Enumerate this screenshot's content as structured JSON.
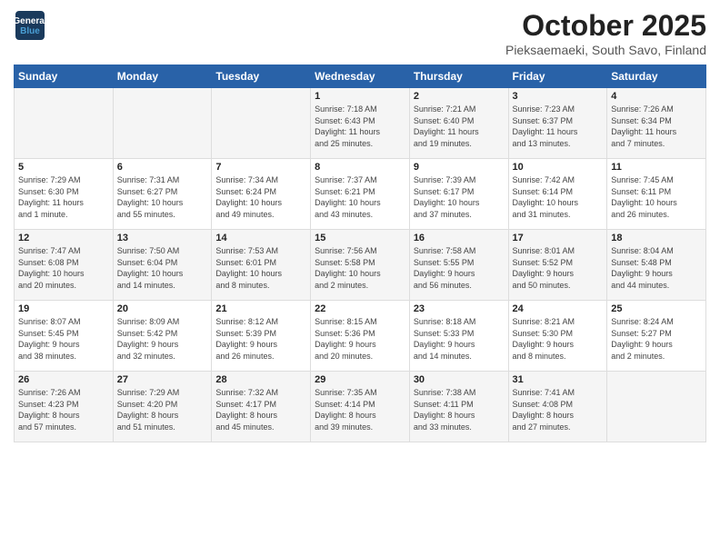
{
  "logo": {
    "line1": "General",
    "line2": "Blue"
  },
  "title": "October 2025",
  "subtitle": "Pieksaemaeki, South Savo, Finland",
  "weekdays": [
    "Sunday",
    "Monday",
    "Tuesday",
    "Wednesday",
    "Thursday",
    "Friday",
    "Saturday"
  ],
  "weeks": [
    [
      {
        "day": "",
        "content": ""
      },
      {
        "day": "",
        "content": ""
      },
      {
        "day": "",
        "content": ""
      },
      {
        "day": "1",
        "content": "Sunrise: 7:18 AM\nSunset: 6:43 PM\nDaylight: 11 hours\nand 25 minutes."
      },
      {
        "day": "2",
        "content": "Sunrise: 7:21 AM\nSunset: 6:40 PM\nDaylight: 11 hours\nand 19 minutes."
      },
      {
        "day": "3",
        "content": "Sunrise: 7:23 AM\nSunset: 6:37 PM\nDaylight: 11 hours\nand 13 minutes."
      },
      {
        "day": "4",
        "content": "Sunrise: 7:26 AM\nSunset: 6:34 PM\nDaylight: 11 hours\nand 7 minutes."
      }
    ],
    [
      {
        "day": "5",
        "content": "Sunrise: 7:29 AM\nSunset: 6:30 PM\nDaylight: 11 hours\nand 1 minute."
      },
      {
        "day": "6",
        "content": "Sunrise: 7:31 AM\nSunset: 6:27 PM\nDaylight: 10 hours\nand 55 minutes."
      },
      {
        "day": "7",
        "content": "Sunrise: 7:34 AM\nSunset: 6:24 PM\nDaylight: 10 hours\nand 49 minutes."
      },
      {
        "day": "8",
        "content": "Sunrise: 7:37 AM\nSunset: 6:21 PM\nDaylight: 10 hours\nand 43 minutes."
      },
      {
        "day": "9",
        "content": "Sunrise: 7:39 AM\nSunset: 6:17 PM\nDaylight: 10 hours\nand 37 minutes."
      },
      {
        "day": "10",
        "content": "Sunrise: 7:42 AM\nSunset: 6:14 PM\nDaylight: 10 hours\nand 31 minutes."
      },
      {
        "day": "11",
        "content": "Sunrise: 7:45 AM\nSunset: 6:11 PM\nDaylight: 10 hours\nand 26 minutes."
      }
    ],
    [
      {
        "day": "12",
        "content": "Sunrise: 7:47 AM\nSunset: 6:08 PM\nDaylight: 10 hours\nand 20 minutes."
      },
      {
        "day": "13",
        "content": "Sunrise: 7:50 AM\nSunset: 6:04 PM\nDaylight: 10 hours\nand 14 minutes."
      },
      {
        "day": "14",
        "content": "Sunrise: 7:53 AM\nSunset: 6:01 PM\nDaylight: 10 hours\nand 8 minutes."
      },
      {
        "day": "15",
        "content": "Sunrise: 7:56 AM\nSunset: 5:58 PM\nDaylight: 10 hours\nand 2 minutes."
      },
      {
        "day": "16",
        "content": "Sunrise: 7:58 AM\nSunset: 5:55 PM\nDaylight: 9 hours\nand 56 minutes."
      },
      {
        "day": "17",
        "content": "Sunrise: 8:01 AM\nSunset: 5:52 PM\nDaylight: 9 hours\nand 50 minutes."
      },
      {
        "day": "18",
        "content": "Sunrise: 8:04 AM\nSunset: 5:48 PM\nDaylight: 9 hours\nand 44 minutes."
      }
    ],
    [
      {
        "day": "19",
        "content": "Sunrise: 8:07 AM\nSunset: 5:45 PM\nDaylight: 9 hours\nand 38 minutes."
      },
      {
        "day": "20",
        "content": "Sunrise: 8:09 AM\nSunset: 5:42 PM\nDaylight: 9 hours\nand 32 minutes."
      },
      {
        "day": "21",
        "content": "Sunrise: 8:12 AM\nSunset: 5:39 PM\nDaylight: 9 hours\nand 26 minutes."
      },
      {
        "day": "22",
        "content": "Sunrise: 8:15 AM\nSunset: 5:36 PM\nDaylight: 9 hours\nand 20 minutes."
      },
      {
        "day": "23",
        "content": "Sunrise: 8:18 AM\nSunset: 5:33 PM\nDaylight: 9 hours\nand 14 minutes."
      },
      {
        "day": "24",
        "content": "Sunrise: 8:21 AM\nSunset: 5:30 PM\nDaylight: 9 hours\nand 8 minutes."
      },
      {
        "day": "25",
        "content": "Sunrise: 8:24 AM\nSunset: 5:27 PM\nDaylight: 9 hours\nand 2 minutes."
      }
    ],
    [
      {
        "day": "26",
        "content": "Sunrise: 7:26 AM\nSunset: 4:23 PM\nDaylight: 8 hours\nand 57 minutes."
      },
      {
        "day": "27",
        "content": "Sunrise: 7:29 AM\nSunset: 4:20 PM\nDaylight: 8 hours\nand 51 minutes."
      },
      {
        "day": "28",
        "content": "Sunrise: 7:32 AM\nSunset: 4:17 PM\nDaylight: 8 hours\nand 45 minutes."
      },
      {
        "day": "29",
        "content": "Sunrise: 7:35 AM\nSunset: 4:14 PM\nDaylight: 8 hours\nand 39 minutes."
      },
      {
        "day": "30",
        "content": "Sunrise: 7:38 AM\nSunset: 4:11 PM\nDaylight: 8 hours\nand 33 minutes."
      },
      {
        "day": "31",
        "content": "Sunrise: 7:41 AM\nSunset: 4:08 PM\nDaylight: 8 hours\nand 27 minutes."
      },
      {
        "day": "",
        "content": ""
      }
    ]
  ]
}
